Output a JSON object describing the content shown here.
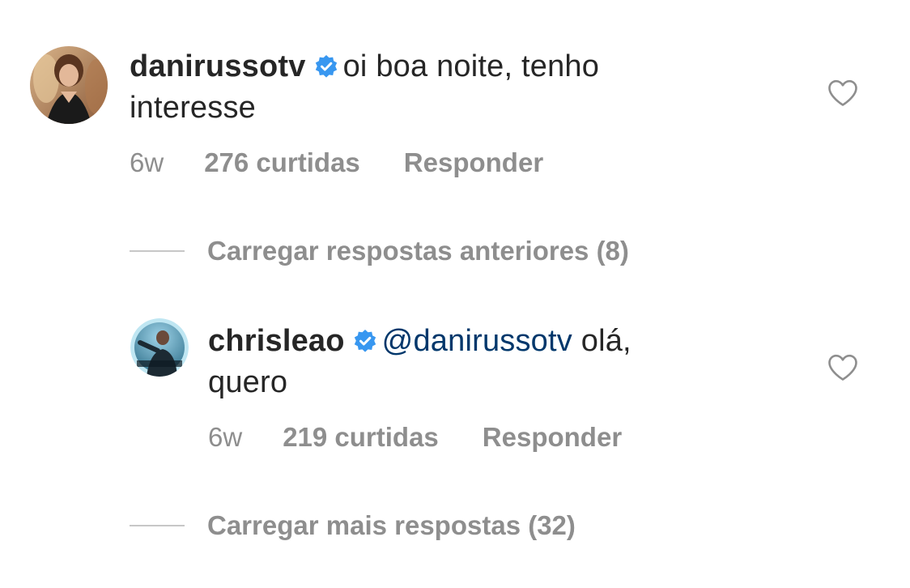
{
  "comments": [
    {
      "username": "danirusso tv",
      "username_text": "danirussotv",
      "verified": true,
      "text": "oi boa noite, tenho interesse",
      "text_line1": "oi boa noite, tenho",
      "text_line2": "interesse",
      "time": "6w",
      "likes": "276 curtidas",
      "reply_label": "Responder",
      "avatar_icon": "avatar-photo",
      "like_icon": "heart-outline-icon"
    },
    {
      "username_text": "chrisleao",
      "verified": true,
      "mention": "@danirussotv",
      "text_line1": "olá,",
      "text_line2": "quero",
      "time": "6w",
      "likes": "219 curtidas",
      "reply_label": "Responder",
      "avatar_icon": "avatar-photo",
      "like_icon": "heart-outline-icon"
    }
  ],
  "load_previous": "Carregar respostas anteriores (8)",
  "load_more": "Carregar mais respostas (32)",
  "colors": {
    "verified_badge": "#3897f0",
    "mention": "#00376b",
    "meta_text": "#8e8e8e",
    "primary_text": "#262626"
  }
}
